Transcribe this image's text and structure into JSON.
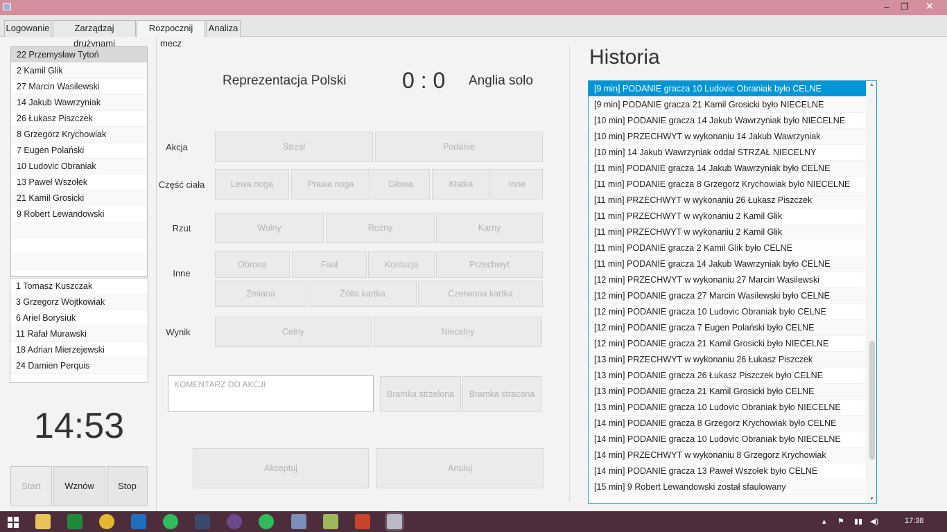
{
  "window": {
    "minimize": "‒",
    "maximize": "❐",
    "close": "✕"
  },
  "tabs": [
    "Logowanie",
    "Zarządzaj drużynami",
    "Rozpocznij mecz",
    "Analiza"
  ],
  "lineup": [
    "22 Przemysław Tytoń",
    "2 Kamil Glik",
    "27 Marcin Wasilewski",
    "14 Jakub Wawrzyniak",
    "26 Łukasz Piszczek",
    "8 Grzegorz Krychowiak",
    "7 Eugen Polański",
    "10 Ludovic Obraniak",
    "13 Paweł Wszołek",
    "21 Kamil Grosicki",
    "9 Robert Lewandowski"
  ],
  "bench": [
    "1 Tomasz Kuszczak",
    "3 Grzegorz Wojtkowiak",
    "6 Ariel Borysiuk",
    "11 Rafał Murawski",
    "18 Adrian Mierzejewski",
    "24 Damien Perquis"
  ],
  "clock": "14:53",
  "controls": {
    "start": "Start",
    "resume": "Wznów",
    "stop": "Stop"
  },
  "match": {
    "home": "Reprezentacja Polski",
    "score": "0 : 0",
    "away": "Anglia solo"
  },
  "labels": {
    "akcja": "Akcja",
    "czesc_ciala": "Część ciała",
    "rzut": "Rzut",
    "inne": "Inne",
    "wynik": "Wynik"
  },
  "buttons": {
    "strzal": "Strzał",
    "podanie": "Podanie",
    "lewa_noga": "Lewa noga",
    "prawa_noga": "Prawa noga",
    "glowa": "Głowa",
    "klatka": "Klatka",
    "inne": "Inne",
    "wolny": "Wolny",
    "rozny": "Rożny",
    "karny": "Karny",
    "obrona": "Obrona",
    "faul": "Faul",
    "kontuzja": "Kontuzja",
    "przechwyt": "Przechwyt",
    "zmiana": "Zmiana",
    "zolta": "Żółta kartka",
    "czerwona": "Czerwona kartka",
    "celny": "Celny",
    "niecelny": "Niecelny",
    "bramka_strzelona": "Bramka strzelona",
    "bramka_stracona": "Bramka stracona",
    "akceptuj": "Akceptuj",
    "anuluj": "Anuluj"
  },
  "comment_placeholder": "KOMENTARZ DO AKCJI",
  "history_title": "Historia",
  "history": [
    "[9 min] PODANIE gracza 10 Ludovic Obraniak było CELNE",
    "[9 min] PODANIE gracza 21 Kamil Grosicki było NIECELNE",
    "[10 min] PODANIE gracza 14 Jakub Wawrzyniak było NIECELNE",
    "[10 min] PRZECHWYT w wykonaniu 14 Jakub Wawrzyniak",
    "[10 min] 14 Jakub Wawrzyniak oddał STRZAŁ NIECELNY",
    "[11 min] PODANIE gracza 14 Jakub Wawrzyniak było CELNE",
    "[11 min] PODANIE gracza 8 Grzegorz Krychowiak było NIECELNE",
    "[11 min] PRZECHWYT w wykonaniu 26 Łukasz Piszczek",
    "[11 min] PRZECHWYT w wykonaniu 2 Kamil Glik",
    "[11 min] PRZECHWYT w wykonaniu 2 Kamil Glik",
    "[11 min] PODANIE gracza 2 Kamil Glik było CELNE",
    "[11 min] PODANIE gracza 14 Jakub Wawrzyniak było CELNE",
    "[12 min] PRZECHWYT w wykonaniu 27 Marcin Wasilewski",
    "[12 min] PODANIE gracza 27 Marcin Wasilewski było CELNE",
    "[12 min] PODANIE gracza 10 Ludovic Obraniak było CELNE",
    "[12 min] PODANIE gracza 7 Eugen Polański było CELNE",
    "[12 min] PODANIE gracza 21 Kamil Grosicki było NIECELNE",
    "[13 min] PRZECHWYT w wykonaniu 26 Łukasz Piszczek",
    "[13 min] PODANIE gracza 26 Łukasz Piszczek było CELNE",
    "[13 min] PODANIE gracza 21 Kamil Grosicki było CELNE",
    "[13 min] PODANIE gracza 10 Ludovic Obraniak było NIECELNE",
    "[14 min] PODANIE gracza 8 Grzegorz Krychowiak było CELNE",
    "[14 min] PODANIE gracza 10 Ludovic Obraniak było NIECELNE",
    "[14 min] PRZECHWYT w wykonaniu 8 Grzegorz Krychowiak",
    "[14 min] PODANIE gracza 13 Paweł Wszołek było CELNE",
    "[15 min] 9 Robert Lewandowski został sfaulowany"
  ],
  "taskbar": {
    "time": "17:38"
  }
}
